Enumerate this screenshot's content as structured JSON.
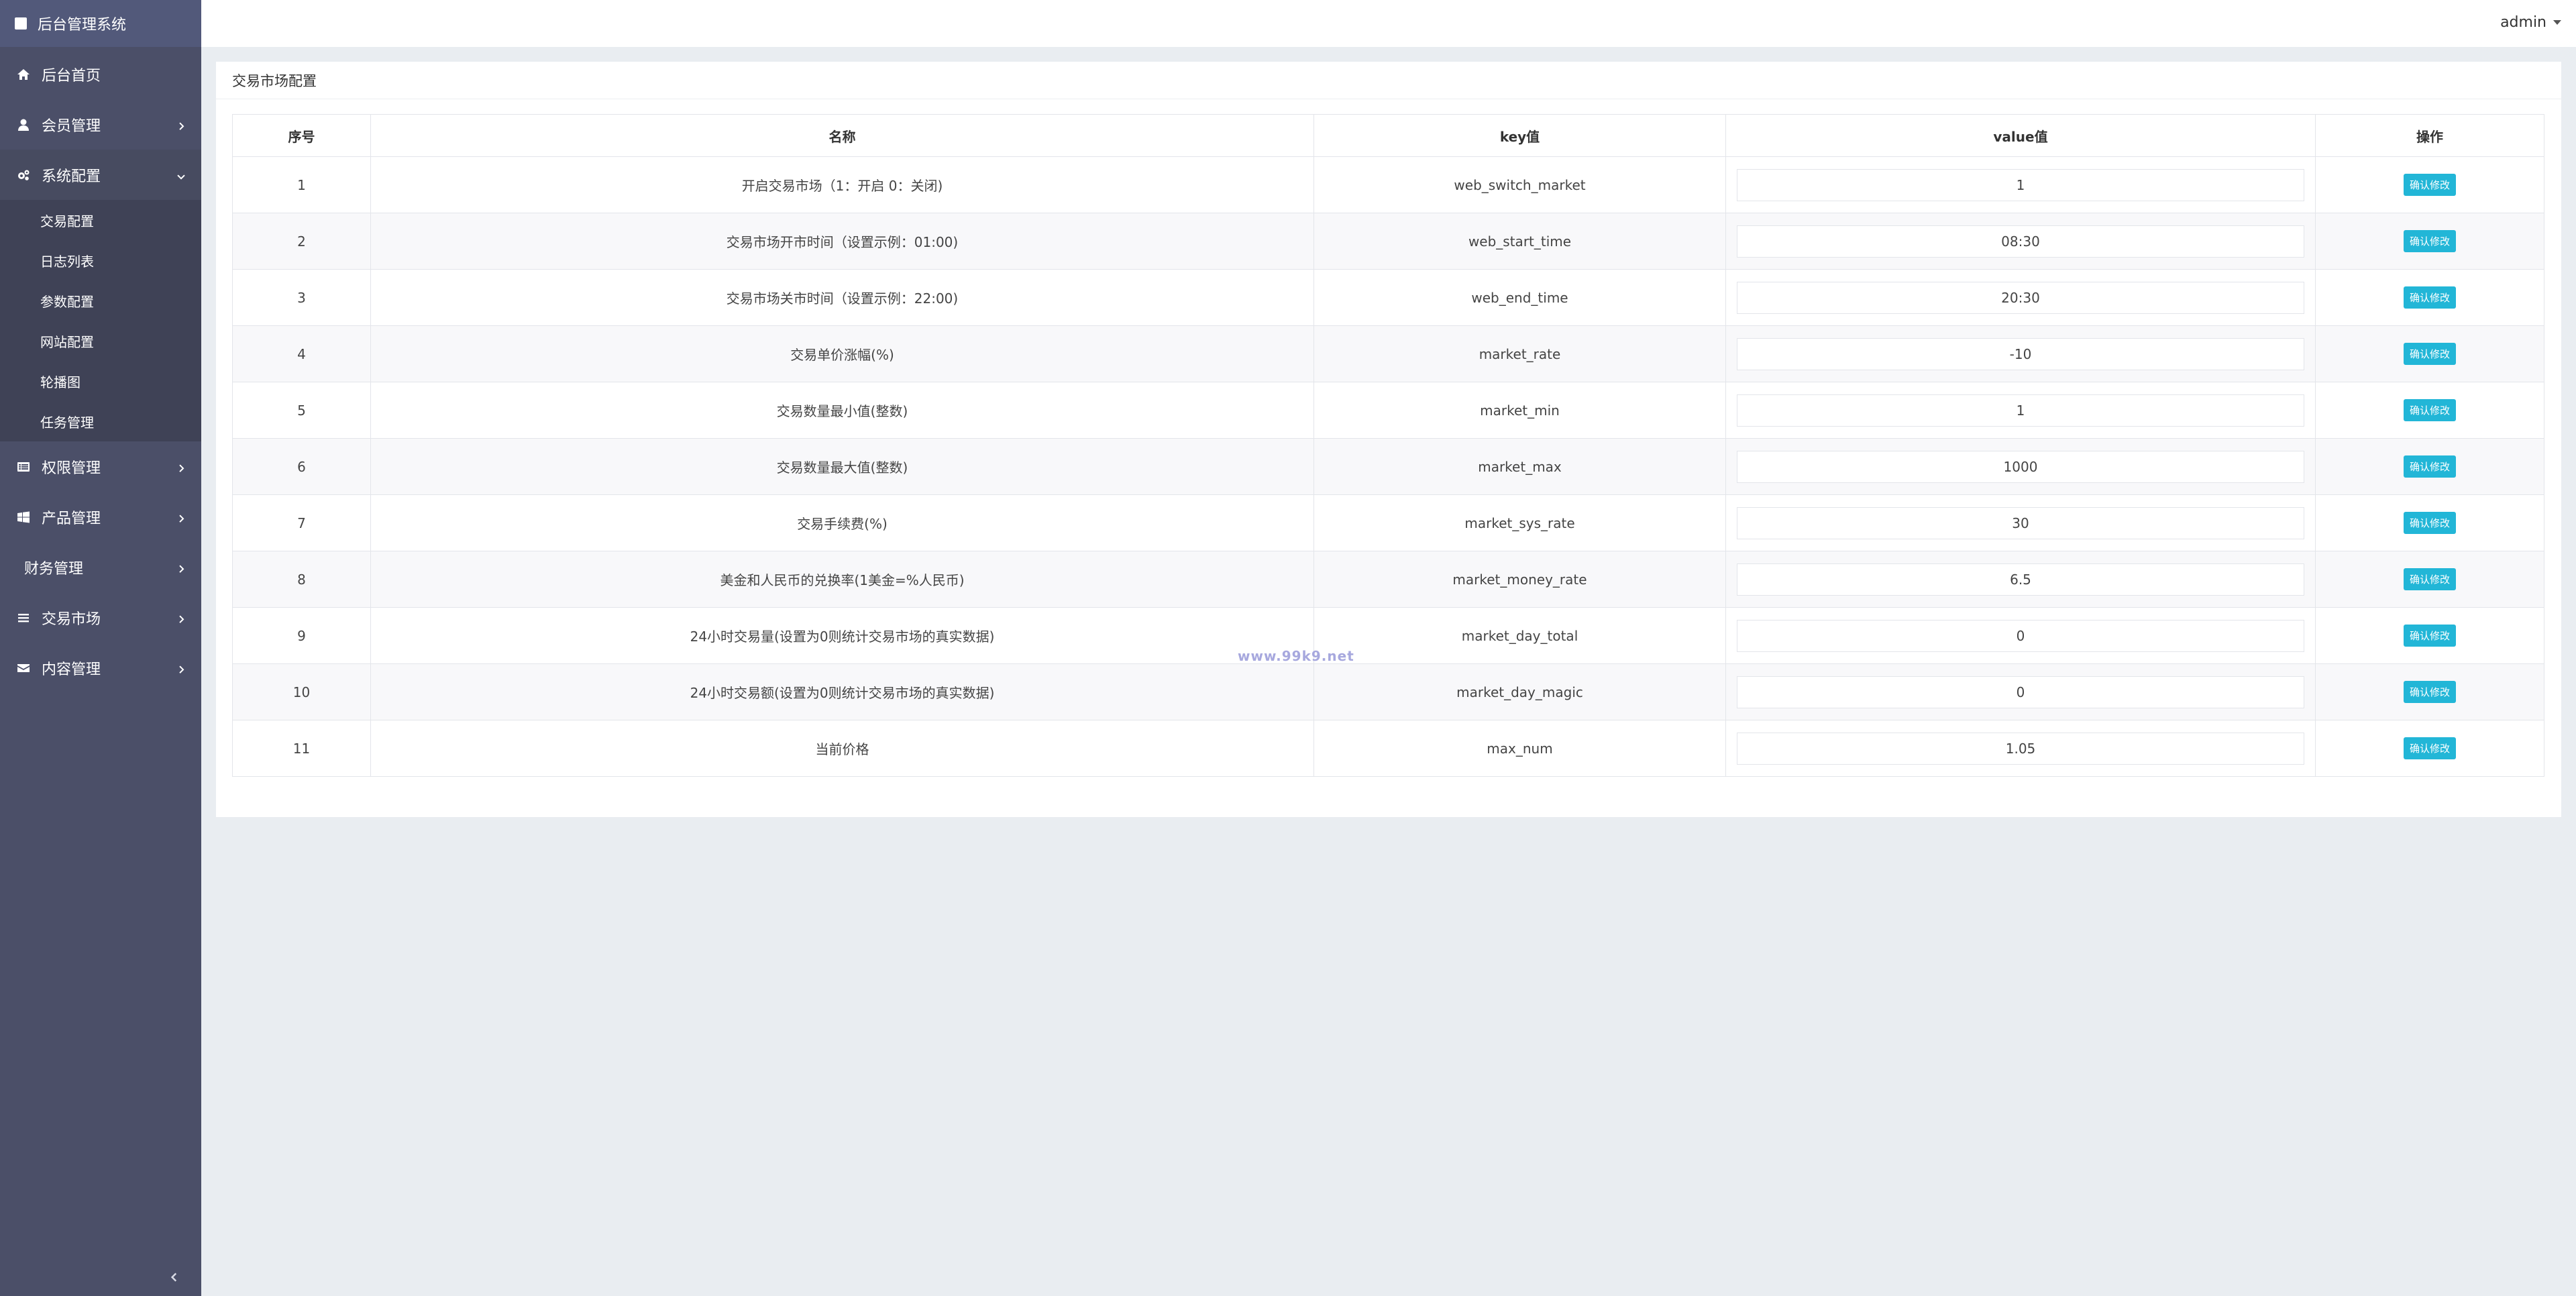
{
  "sidebar": {
    "brand": "后台管理系统",
    "items": [
      {
        "label": "后台首页",
        "icon": "home-icon"
      },
      {
        "label": "会员管理",
        "icon": "user-icon"
      },
      {
        "label": "系统配置",
        "icon": "gears-icon",
        "open": true,
        "children": [
          "交易配置",
          "日志列表",
          "参数配置",
          "网站配置",
          "轮播图",
          "任务管理"
        ]
      },
      {
        "label": "权限管理",
        "icon": "list-box-icon"
      },
      {
        "label": "产品管理",
        "icon": "windows-icon"
      },
      {
        "label": "财务管理",
        "icon": ""
      },
      {
        "label": "交易市场",
        "icon": "list-icon"
      },
      {
        "label": "内容管理",
        "icon": "envelope-icon"
      }
    ]
  },
  "topbar": {
    "user": "admin"
  },
  "panel": {
    "title": "交易市场配置",
    "columns": [
      "序号",
      "名称",
      "key值",
      "value值",
      "操作"
    ],
    "button_label": "确认修改",
    "rows": [
      {
        "no": "1",
        "name": "开启交易市场（1：开启 0：关闭)",
        "key": "web_switch_market",
        "value": "1"
      },
      {
        "no": "2",
        "name": "交易市场开市时间（设置示例：01:00)",
        "key": "web_start_time",
        "value": "08:30"
      },
      {
        "no": "3",
        "name": "交易市场关市时间（设置示例：22:00)",
        "key": "web_end_time",
        "value": "20:30"
      },
      {
        "no": "4",
        "name": "交易单价涨幅(%)",
        "key": "market_rate",
        "value": "-10"
      },
      {
        "no": "5",
        "name": "交易数量最小值(整数)",
        "key": "market_min",
        "value": "1"
      },
      {
        "no": "6",
        "name": "交易数量最大值(整数)",
        "key": "market_max",
        "value": "1000"
      },
      {
        "no": "7",
        "name": "交易手续费(%)",
        "key": "market_sys_rate",
        "value": "30"
      },
      {
        "no": "8",
        "name": "美金和人民币的兑换率(1美金=%人民币)",
        "key": "market_money_rate",
        "value": "6.5"
      },
      {
        "no": "9",
        "name": "24小时交易量(设置为0则统计交易市场的真实数据)",
        "key": "market_day_total",
        "value": "0"
      },
      {
        "no": "10",
        "name": "24小时交易额(设置为0则统计交易市场的真实数据)",
        "key": "market_day_magic",
        "value": "0"
      },
      {
        "no": "11",
        "name": "当前价格",
        "key": "max_num",
        "value": "1.05"
      }
    ]
  },
  "watermark": "www.99k9.net",
  "colors": {
    "sidebar_bg": "#4b4f68",
    "sidebar_brand_bg": "#52597a",
    "submenu_bg": "#3f4256",
    "page_bg": "#e9edf1",
    "button": "#22b6d7",
    "watermark": "#a7a8de"
  }
}
